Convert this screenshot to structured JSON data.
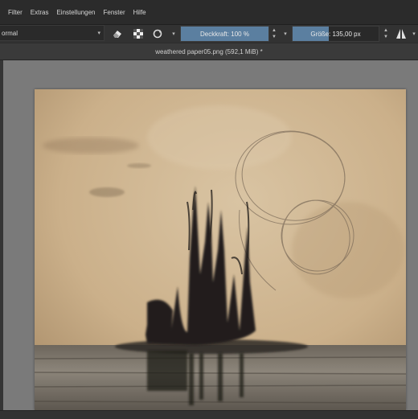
{
  "menu": [
    "Filter",
    "Extras",
    "Einstellungen",
    "Fenster",
    "Hilfe"
  ],
  "toolbar": {
    "blend_mode": "ormal",
    "opacity_label": "Deckkraft: 100 %",
    "opacity_level": 1.0,
    "size_label": "Größe: 135,00 px",
    "size_level": 0.42
  },
  "document": {
    "tab_title": "weathered paper05.png (592,1 MiB) *"
  },
  "colors": {
    "accent": "#5b7fa0",
    "workspace": "#7a7a7a",
    "panel": "#323232"
  },
  "icons": [
    "eraser-icon",
    "alpha-checker-icon",
    "reset-icon",
    "mirror-icon"
  ]
}
